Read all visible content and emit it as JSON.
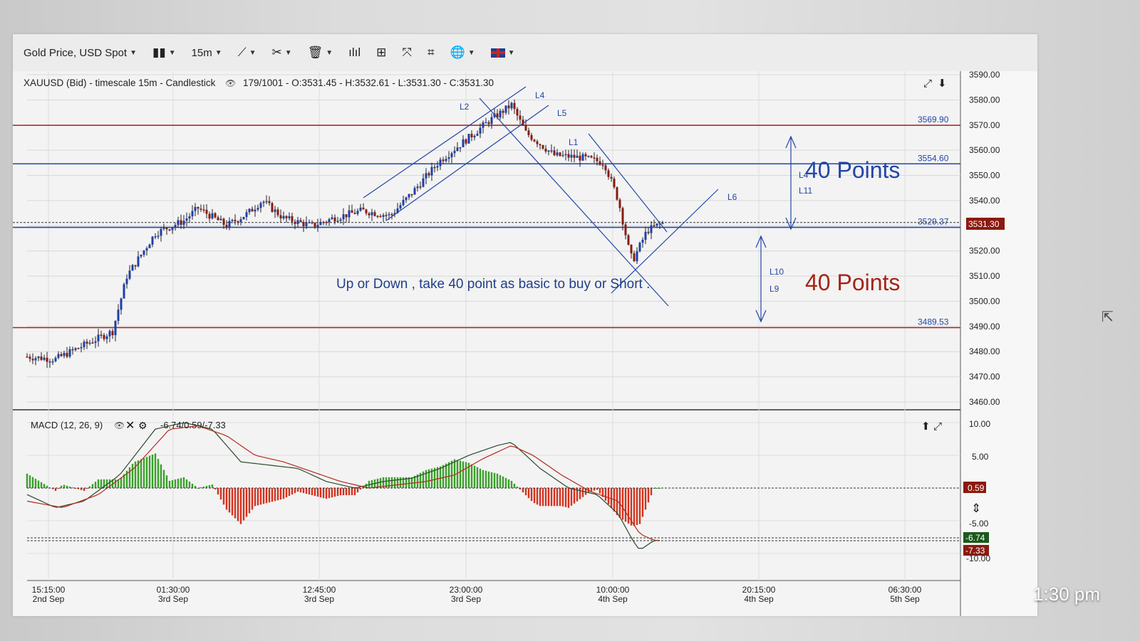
{
  "toolbar": {
    "instrument": "Gold Price, USD Spot",
    "timeframe": "15m",
    "icons": [
      "candlestick-icon",
      "line-tool-icon",
      "draw-tool-icon",
      "trash-icon",
      "bar-chart-icon",
      "layout-icon",
      "fullscreen-icon",
      "crop-icon",
      "globe-icon",
      "flag-uk-icon"
    ]
  },
  "main_chart": {
    "info": "XAUUSD (Bid) - timescale 15m - Candlestick",
    "ohlc": "179/1001 - O:3531.45 - H:3532.61 - L:3531.30 - C:3531.30",
    "current_price": "3531.30",
    "price_ticks": [
      "3590.00",
      "3580.00",
      "3570.00",
      "3560.00",
      "3550.00",
      "3540.00",
      "3530.00",
      "3520.00",
      "3510.00",
      "3500.00",
      "3490.00",
      "3480.00",
      "3470.00",
      "3460.00"
    ],
    "level_labels": [
      "3569.90",
      "3554.60",
      "3529.37",
      "3489.53"
    ],
    "line_labels": {
      "l1": "L1",
      "l2": "L2",
      "l4": "L4",
      "l5": "L5",
      "l6": "L6",
      "l9": "L9",
      "l10": "L10",
      "l11": "L11",
      "l4b": "L4"
    },
    "annotation_up": "40 Points",
    "annotation_down": "40 Points",
    "annotation_text": "Up or Down , take 40 point as basic to buy or Short ."
  },
  "macd": {
    "label": "MACD (12, 26, 9)",
    "values": "-6.74/0.59/-7.33",
    "ticks": [
      "10.00",
      "5.00",
      "-5.00",
      "-10.00"
    ],
    "hist_badge": "0.59",
    "macd_badge": "-6.74",
    "signal_badge": "-7.33"
  },
  "time_axis": [
    {
      "time": "15:15:00",
      "date": "2nd Sep"
    },
    {
      "time": "01:30:00",
      "date": "3rd Sep"
    },
    {
      "time": "12:45:00",
      "date": "3rd Sep"
    },
    {
      "time": "23:00:00",
      "date": "3rd Sep"
    },
    {
      "time": "10:00:00",
      "date": "4th Sep"
    },
    {
      "time": "20:15:00",
      "date": "4th Sep"
    },
    {
      "time": "06:30:00",
      "date": "5th Sep"
    }
  ],
  "chart_data": {
    "type": "line",
    "title": "XAUUSD (Bid) - timescale 15m - Candlestick",
    "x": [
      0,
      10,
      20,
      30,
      40,
      50,
      60,
      70,
      80,
      90,
      100,
      110,
      120,
      130,
      140,
      150,
      160,
      170,
      180
    ],
    "series": [
      {
        "values": [
          3478,
          3477,
          3484,
          3490,
          3512,
          3528,
          3532,
          3534,
          3530,
          3536,
          3532,
          3530,
          3534,
          3540,
          3534,
          3545,
          3560,
          3572,
          3578
        ]
      },
      {
        "values": [
          3565,
          3562,
          3558,
          3559,
          3557,
          3555,
          3540,
          3528,
          3516,
          3526,
          3531
        ]
      }
    ],
    "ylim": [
      3460,
      3590
    ],
    "levels": [
      3569.9,
      3554.6,
      3529.37,
      3489.53
    ]
  },
  "status_time": "1:30 pm"
}
